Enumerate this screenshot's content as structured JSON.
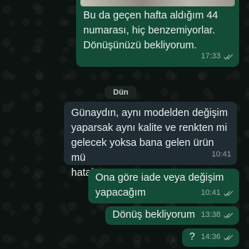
{
  "messages": [
    {
      "direction": "outgoing",
      "text": "Bu da geçen hafta aldığım 44\nnumarası, hiç benzemiyorlar.\nDönüşünüzü bekliyorum.",
      "time": "17:33",
      "status": "read"
    },
    {
      "direction": "incoming",
      "text": "Günaydın, aynı modelden değişim\nyaparsak aynı kalite ve renkten mi\ngelecek yoksa bana gelen ürün mü\nhatalu",
      "time": "10:41"
    },
    {
      "direction": "outgoing",
      "text": "Ona göre iade veya değişim\nyapacağım",
      "time": "10:41",
      "status": "read"
    },
    {
      "direction": "outgoing",
      "text": "Dönüş bekliyorum",
      "time": "13:38",
      "status": "read"
    },
    {
      "direction": "outgoing",
      "text": "?",
      "time": "14:36",
      "status": "read"
    }
  ],
  "date_separator": "Dün",
  "colors": {
    "outgoing_bubble": "#144d37",
    "incoming_bubble": "#1f2c33",
    "background": "#0d1311",
    "text": "#e9edef",
    "meta_text": "#9aa4a8"
  },
  "icons": {
    "read_receipt": "double-check-icon"
  }
}
